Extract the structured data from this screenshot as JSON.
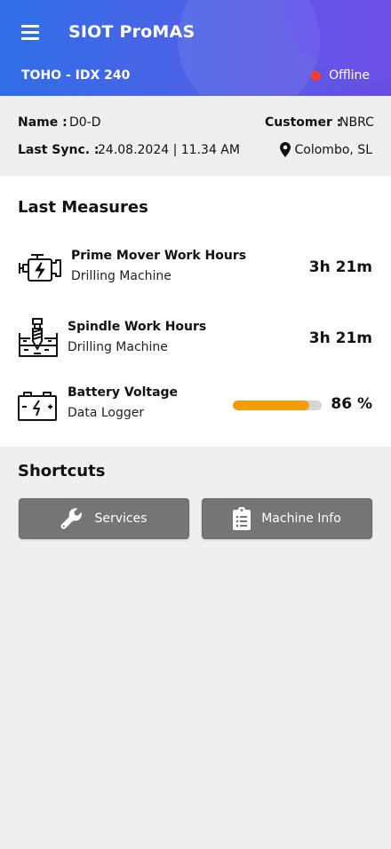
{
  "header": {
    "app_title": "SIOT ProMAS",
    "device_name": "TOHO - IDX 240",
    "status_text": "Offline",
    "status_color": "#ff3b30",
    "menu_icon": "hamburger-menu-icon"
  },
  "info": {
    "name_label": "Name :",
    "name_value": "D0-D",
    "customer_label": "Customer :",
    "customer_value": "NBRC",
    "sync_label": "Last Sync. :",
    "sync_value": "24.08.2024 | 11.34 AM",
    "location": "Colombo, SL",
    "location_icon": "map-pin-icon"
  },
  "measures": {
    "title": "Last Measures",
    "items": [
      {
        "title": "Prime Mover Work Hours",
        "subtitle": "Drilling Machine",
        "value": "3h 21m",
        "icon": "engine-icon"
      },
      {
        "title": "Spindle Work Hours",
        "subtitle": "Drilling Machine",
        "value": "3h 21m",
        "icon": "drill-spindle-icon"
      },
      {
        "title": "Battery Voltage",
        "subtitle": "Data Logger",
        "value": "86 %",
        "percent": 86,
        "icon": "battery-icon",
        "bar_color": "#f59c00"
      }
    ]
  },
  "shortcuts": {
    "title": "Shortcuts",
    "buttons": [
      {
        "label": "Services",
        "icon": "wrench-icon"
      },
      {
        "label": "Machine Info",
        "icon": "clipboard-list-icon"
      }
    ]
  }
}
